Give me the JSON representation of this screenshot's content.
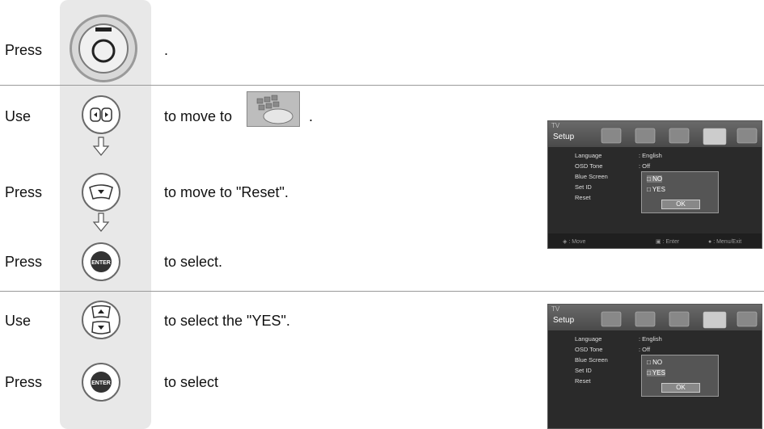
{
  "steps": {
    "s1": {
      "label": "Press",
      "text": "."
    },
    "s2": {
      "label": "Use",
      "text": "to move to",
      "suffix": "."
    },
    "s3": {
      "label": "Press",
      "text": "to move to  \"Reset\"."
    },
    "s4": {
      "label": "Press",
      "text": "to select."
    },
    "s5": {
      "label": "Use",
      "text": "to select the \"YES\"."
    },
    "s6": {
      "label": "Press",
      "text": "to select"
    }
  },
  "buttons": {
    "enter_text": "ENTER"
  },
  "tv1": {
    "source": "TV",
    "menu_title": "Setup",
    "items": [
      "Language",
      "OSD Tone",
      "Blue Screen",
      "Set ID",
      "Reset"
    ],
    "values": [
      ": English",
      ": Off"
    ],
    "popup": {
      "options": [
        "NO",
        "YES"
      ],
      "ok": "OK"
    },
    "hints": [
      ": Move",
      ": Enter",
      ": Menu/Exit"
    ]
  },
  "tv2": {
    "source": "TV",
    "menu_title": "Setup",
    "items": [
      "Language",
      "OSD Tone",
      "Blue Screen",
      "Set ID",
      "Reset"
    ],
    "values": [
      ": English",
      ": Off"
    ],
    "popup": {
      "options": [
        "NO",
        "YES"
      ],
      "ok": "OK"
    }
  }
}
